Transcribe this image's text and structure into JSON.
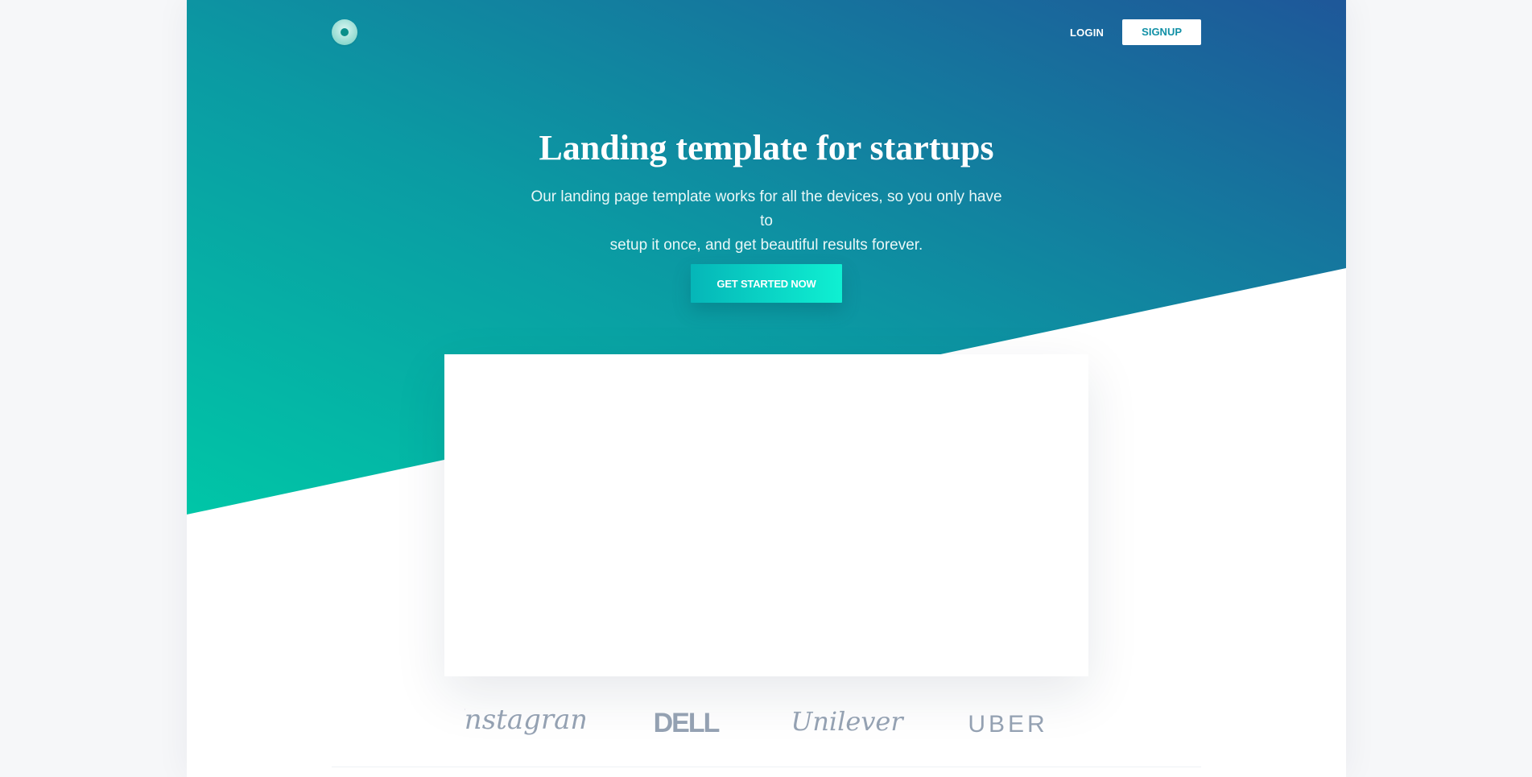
{
  "header": {
    "logo": {
      "icon": "circle-logo-icon"
    },
    "nav": {
      "login_label": "LOGIN",
      "signup_label": "SIGNUP"
    }
  },
  "hero": {
    "title": "Landing template for startups",
    "paragraph_line1": "Our landing page template works for all the devices, so you only have to",
    "paragraph_line2": "setup it once, and get beautiful results forever.",
    "cta_label": "GET STARTED NOW"
  },
  "clients": {
    "logos": [
      "Instagram",
      "DELL",
      "Unilever",
      "UBER"
    ]
  },
  "colors": {
    "hero_gradient_start": "#00c6a7",
    "hero_gradient_end": "#1e5799",
    "cta_start": "#05b6b8",
    "cta_end": "#0ff0d2",
    "client_logo": "#94a1b2",
    "signup_text": "#1190a6"
  }
}
